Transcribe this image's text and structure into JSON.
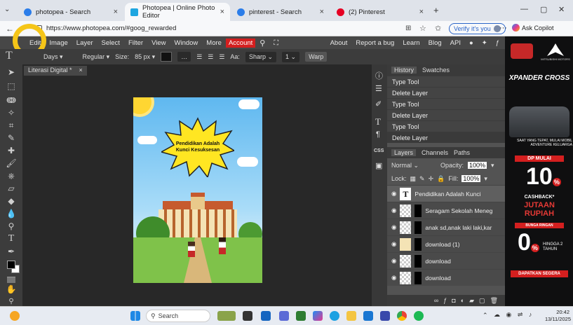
{
  "browser": {
    "tabs": [
      {
        "label": "photopea - Search",
        "close": "×",
        "favicon_color": "#2b7de9"
      },
      {
        "label": "Photopea | Online Photo Editor",
        "close": "×",
        "favicon_color": "#1ea6e0"
      },
      {
        "label": "pinterest - Search",
        "close": "×",
        "favicon_color": "#2b7de9"
      },
      {
        "label": "(2) Pinterest",
        "close": "×",
        "favicon_color": "#e60023"
      }
    ],
    "new_tab": "+",
    "url": "https://www.photopea.com/#goog_rewarded",
    "verify_label": "Verify it's you",
    "ask_copilot": "Ask Copilot",
    "more": "···"
  },
  "menubar": {
    "items": [
      "Edit",
      "Image",
      "Layer",
      "Select",
      "Filter",
      "View",
      "Window",
      "More"
    ],
    "account": "Account",
    "right_items": [
      "About",
      "Report a bug",
      "Learn",
      "Blog",
      "API"
    ]
  },
  "options": {
    "font": "Days",
    "style": "Regular",
    "size_label": "Size:",
    "size": "85 px",
    "aa_label": "Aa:",
    "aa": "Sharp",
    "line": "1",
    "warp": "Warp"
  },
  "document": {
    "tab_label": "Literasi Digital *",
    "close": "×",
    "poster_title": "Pendidikan Adalah Kunci Kesuksesan",
    "poster_title_line1": "Pendidikan Adalah",
    "poster_title_line2": "Kunci Kesuksesan"
  },
  "history": {
    "tabs": [
      "History",
      "Swatches"
    ],
    "items": [
      "Type Tool",
      "Delete Layer",
      "Type Tool",
      "Delete Layer",
      "Type Tool",
      "Delete Layer"
    ]
  },
  "layers": {
    "tabs": [
      "Layers",
      "Channels",
      "Paths"
    ],
    "blend": "Normal",
    "opacity_label": "Opacity:",
    "opacity": "100%",
    "lock_label": "Lock:",
    "fill_label": "Fill:",
    "fill": "100%",
    "items": [
      {
        "name": "Pendidikan Adalah Kunci",
        "type": "text"
      },
      {
        "name": "Seragam Sekolah Meneg",
        "type": "image"
      },
      {
        "name": "anak sd,anak laki laki,kar",
        "type": "image"
      },
      {
        "name": "download (1)",
        "type": "image"
      },
      {
        "name": "download",
        "type": "image"
      },
      {
        "name": "download",
        "type": "image"
      }
    ]
  },
  "ad": {
    "brand": "XPANDER CROSS",
    "maker": "MITSUBISHI MOTORS",
    "tagline": "SAAT YANG TEPAT, MULAI MOBIL ADVENTURE KELUARGA",
    "dp_label": "DP MULAI",
    "dp_value": "10",
    "dp_unit": "%",
    "cashback": "CASHBACK*",
    "cashback_value": "JUTAAN",
    "cashback_unit": "RUPIAH",
    "rate_label": "BUNGA RINGAN",
    "rate_value": "0",
    "rate_unit": "%",
    "rate_note": "HINGGA 2 TAHUN",
    "cta": "DAPATKAN SEGERA"
  },
  "taskbar": {
    "search": "Search",
    "time": "20:42",
    "date": "13/11/2025"
  },
  "colors": {
    "accent_highlight": "#f5c518",
    "account_red": "#d41f1f"
  }
}
